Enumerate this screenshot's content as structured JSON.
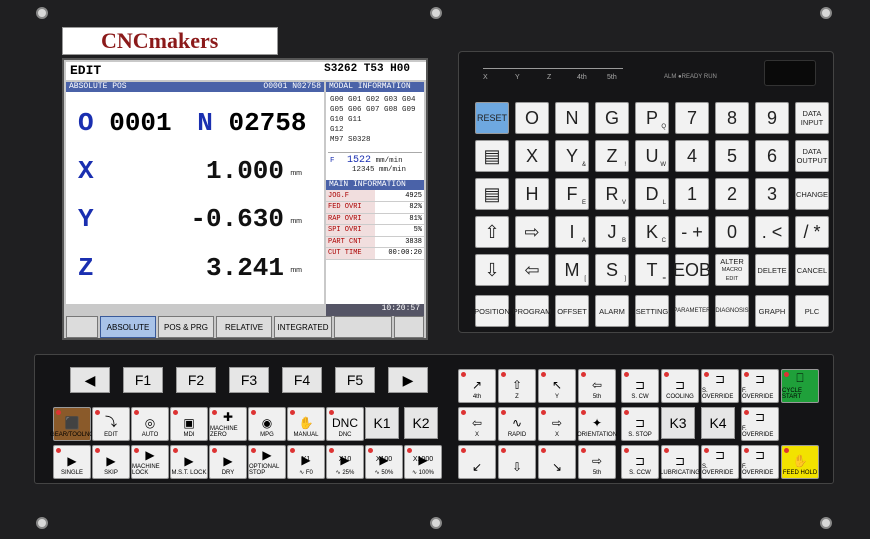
{
  "logo": "CNCmakers",
  "screen": {
    "mode": "EDIT",
    "status": "S3262 T53 H00",
    "pos_header_left": "ABSOLUTE POS",
    "pos_header_right": "O0001 N02758",
    "program_label_o": "O",
    "program_o": "0001",
    "program_label_n": "N",
    "program_n": "02758",
    "axes": [
      {
        "name": "X",
        "value": "1.000",
        "unit": "mm"
      },
      {
        "name": "Y",
        "value": "-0.630",
        "unit": "mm"
      },
      {
        "name": "Z",
        "value": "3.241",
        "unit": "mm"
      }
    ],
    "modal_header": "MODAL INFORMATION",
    "gcodes": [
      "G00 G01 G02 G03 G04",
      "G05 G06 G07 G08 G09",
      "G10 G11",
      "G12",
      "M97 S0328"
    ],
    "feed_label": "F",
    "feed_value": "1522",
    "feed_unit": "mm/min",
    "feed2_value": "12345",
    "feed2_unit": "mm/min",
    "main_header": "MAIN INFORMATION",
    "main_info": [
      {
        "k": "JOG.F",
        "v": "4925"
      },
      {
        "k": "FED OVRI",
        "v": "82%"
      },
      {
        "k": "RAP OVRI",
        "v": "81%"
      },
      {
        "k": "SPI OVRI",
        "v": "5%"
      },
      {
        "k": "PART CNT",
        "v": "3838"
      },
      {
        "k": "CUT TIME",
        "v": "00:00:20"
      }
    ],
    "clock": "10:20:57",
    "softkeys": [
      "ABSOLUTE",
      "POS & PRG",
      "RELATIVE",
      "INTEGRATED"
    ]
  },
  "keypad": {
    "axis_strip": [
      "X",
      "Y",
      "Z",
      "4th",
      "5th"
    ],
    "leds": "ALM  ●READY  RUN",
    "keys": [
      [
        "RESET",
        "O",
        "N",
        "G",
        "P",
        "7",
        "8",
        "9",
        "DATA INPUT"
      ],
      [
        "▤",
        "X",
        "Y",
        "Z",
        "U",
        "4",
        "5",
        "6",
        "DATA OUTPUT"
      ],
      [
        "▤",
        "H",
        "F",
        "R",
        "D",
        "1",
        "2",
        "3",
        "CHANGE"
      ],
      [
        "⇧",
        "⇨",
        "I",
        "J",
        "K",
        "- +",
        "0",
        ". <",
        "/ *"
      ],
      [
        "⇩",
        "⇦",
        "M",
        "S",
        "T",
        "EOB",
        "ALTER",
        "DELETE",
        "CANCEL"
      ]
    ],
    "subs": {
      "P": "Q",
      "Y": "&",
      "Z": "!",
      "U": "W",
      "F": "E",
      "R": "V",
      "D": "L",
      "I": "A",
      "J": "B",
      "K": "C",
      "M": "[",
      "S": "]",
      "T": "="
    },
    "alter_sub": "MACRO EDIT",
    "func_keys": [
      "POSITION",
      "PROGRAM",
      "OFFSET",
      "ALARM",
      "SETTING",
      "PARAMETER",
      "DIAGNOSIS",
      "GRAPH",
      "PLC"
    ]
  },
  "bottom": {
    "fkeys": [
      "◀",
      "F1",
      "F2",
      "F3",
      "F4",
      "F5",
      "▶"
    ],
    "row1": [
      "GEAR/TOOLNO",
      "EDIT",
      "AUTO",
      "MDI",
      "MACHINE ZERO",
      "MPG",
      "MANUAL",
      "DNC",
      "K1",
      "K2"
    ],
    "row2": [
      "SINGLE",
      "SKIP",
      "MACHINE LOCK",
      "M.S.T. LOCK",
      "DRY",
      "OPTIONAL STOP",
      "∿ F0",
      "∿ 25%",
      "∿ 50%",
      "∿ 100%"
    ],
    "jog_row1": [
      "4th",
      "Z",
      "Y",
      "5th"
    ],
    "jog_row2": [
      "X",
      "RAPID",
      "X",
      "ORIENTATION"
    ],
    "jog_row3": [
      "",
      "",
      "",
      "5th"
    ],
    "spindle_row1": [
      "S. CW",
      "COOLING",
      "S. OVERRIDE",
      "F. OVERRIDE",
      "CYCLE START"
    ],
    "spindle_row2": [
      "S. STOP",
      "K3",
      "K4",
      "F. OVERRIDE"
    ],
    "spindle_row3": [
      "S. CCW",
      "LUBRICATING",
      "S. OVERRIDE",
      "F. OVERRIDE",
      "FEED HOLD"
    ],
    "row2_top": [
      "",
      "",
      "",
      "",
      "",
      "",
      "X1",
      "X10",
      "X100",
      "X1000"
    ]
  }
}
